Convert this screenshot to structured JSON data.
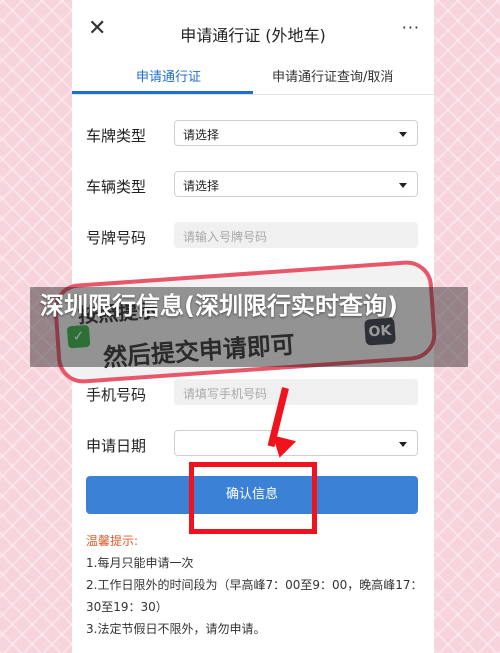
{
  "header": {
    "close_icon": "close-icon",
    "title": "申请通行证 (外地车)",
    "more": "···"
  },
  "tabs": [
    {
      "label": "申请通行证",
      "active": true
    },
    {
      "label": "申请通行证查询/取消",
      "active": false
    }
  ],
  "form": {
    "plate_type": {
      "label": "车牌类型",
      "value": "请选择"
    },
    "vehicle_type": {
      "label": "车辆类型",
      "value": "请选择"
    },
    "plate_number": {
      "label": "号牌号码",
      "placeholder": "请输入号牌号码"
    },
    "phone": {
      "label": "手机号码",
      "placeholder": "请填写手机号码"
    },
    "apply_date": {
      "label": "申请日期",
      "value": ""
    }
  },
  "confirm_label": "确认信息",
  "tips": {
    "title": "温馨提示:",
    "items": [
      "1.每月只能申请一次",
      "2.工作日限外的时间段为（早高峰7：00至9：00，晚高峰17：30至19：30）",
      "3.法定节假日不限外，请勿申请。"
    ]
  },
  "sticker": {
    "line1": "按照提示",
    "line2": "然后提交申请即可",
    "ok": "OK"
  },
  "overlay_title": "深圳限行信息(深圳限行实时查询)",
  "colors": {
    "accent": "#1f6fd1",
    "button": "#3b82d6",
    "highlight": "#f0121c"
  }
}
